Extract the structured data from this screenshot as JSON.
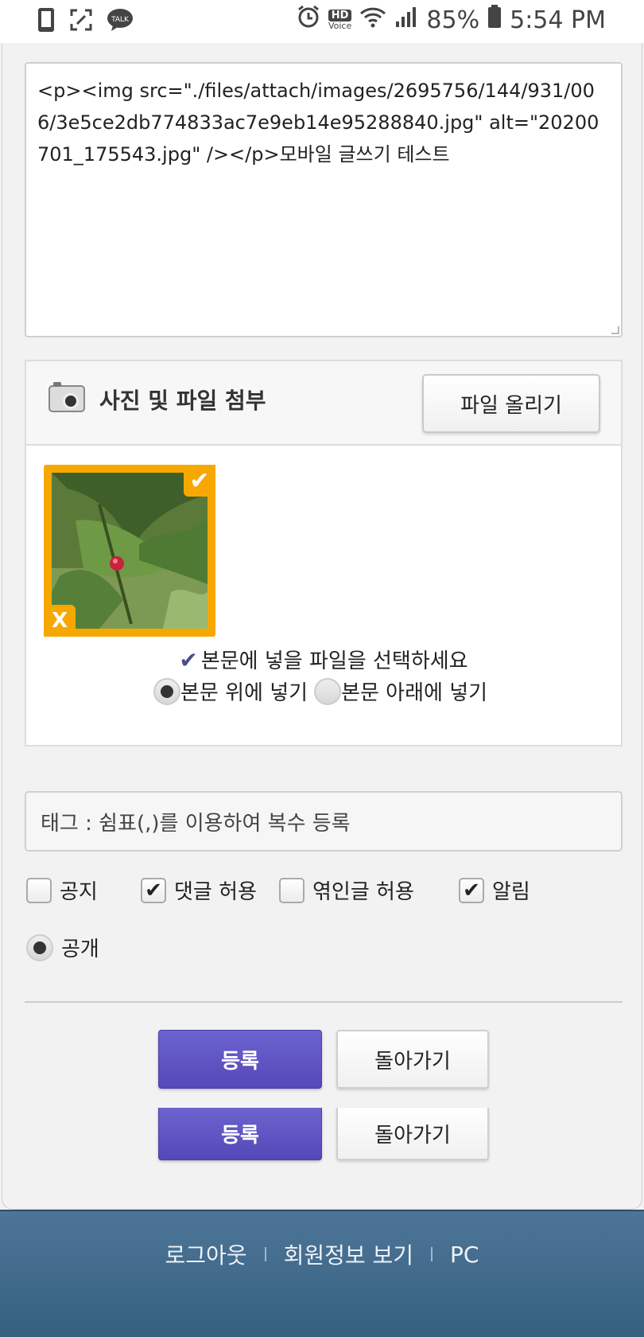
{
  "status_bar": {
    "battery": "85%",
    "time": "5:54 PM",
    "hd_label": "HD",
    "voice_label": "Voice",
    "talk_label": "TALK"
  },
  "editor": {
    "content": "<p><img src=\"./files/attach/images/2695756/144/931/006/3e5ce2db774833ac7e9eb14e95288840.jpg\" alt=\"20200701_175543.jpg\" /></p>모바일 글쓰기 테스트"
  },
  "attachment": {
    "title": "사진 및 파일 첨부",
    "upload_button": "파일 올리기",
    "thumb_check": "✔",
    "thumb_delete": "X",
    "select_hint": "본문에 넣을 파일을 선택하세요",
    "place_above": "본문 위에 넣기",
    "place_below": "본문 아래에 넣기"
  },
  "tag_field": {
    "placeholder": "태그 : 쉼표(,)를 이용하여 복수 등록"
  },
  "options": {
    "notice": {
      "label": "공지",
      "checked": false
    },
    "allow_comments": {
      "label": "댓글 허용",
      "checked": true
    },
    "allow_trackback": {
      "label": "엮인글 허용",
      "checked": false
    },
    "notify": {
      "label": "알림",
      "checked": true
    },
    "public": {
      "label": "공개",
      "selected": true
    }
  },
  "buttons": {
    "submit": "등록",
    "back": "돌아가기"
  },
  "footer": {
    "logout": "로그아웃",
    "member_info": "회원정보 보기",
    "pc": "PC"
  },
  "colors": {
    "accent_purple": "#5f55c4",
    "thumb_orange": "#f6a800",
    "footer_blue": "#436a8c"
  }
}
